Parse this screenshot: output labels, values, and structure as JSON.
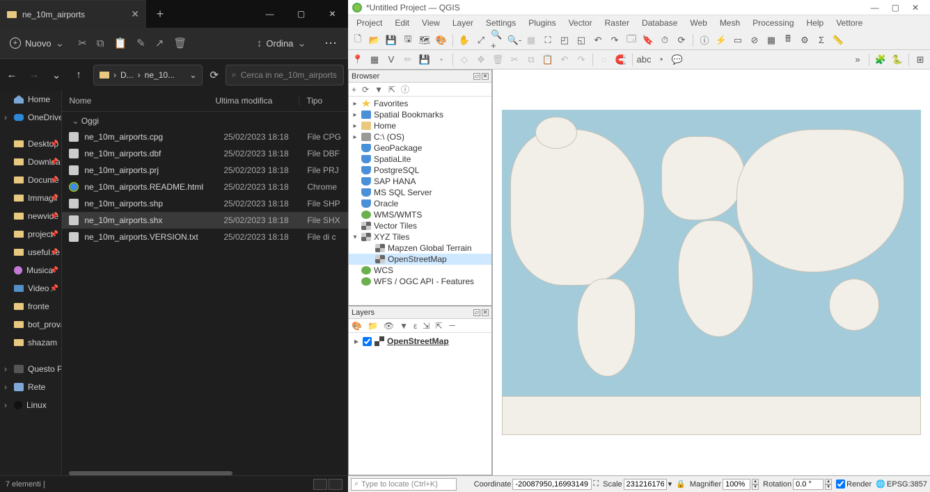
{
  "fe": {
    "tab_title": "ne_10m_airports",
    "new_button": "Nuovo",
    "sort_button": "Ordina",
    "breadcrumb": {
      "p1": "D...",
      "sep": "›",
      "p2": "ne_10..."
    },
    "search_placeholder": "Cerca in ne_10m_airports",
    "side_items": [
      {
        "label": "Home",
        "cls": "home",
        "exp": false,
        "pin": false
      },
      {
        "label": "OneDrive -",
        "cls": "od",
        "exp": true,
        "pin": false
      },
      {
        "label": "Desktop",
        "cls": "f",
        "exp": false,
        "pin": true
      },
      {
        "label": "Downloa",
        "cls": "f",
        "exp": false,
        "pin": true
      },
      {
        "label": "Docume",
        "cls": "f",
        "exp": false,
        "pin": true
      },
      {
        "label": "Immagir",
        "cls": "f",
        "exp": false,
        "pin": true
      },
      {
        "label": "newvide",
        "cls": "f",
        "exp": false,
        "pin": true
      },
      {
        "label": "project",
        "cls": "f",
        "exp": false,
        "pin": true
      },
      {
        "label": "useful re",
        "cls": "f",
        "exp": false,
        "pin": true
      },
      {
        "label": "Musica",
        "cls": "mus",
        "exp": false,
        "pin": true
      },
      {
        "label": "Video",
        "cls": "vid",
        "exp": false,
        "pin": true
      },
      {
        "label": "fronte",
        "cls": "f",
        "exp": false,
        "pin": false
      },
      {
        "label": "bot_prova",
        "cls": "f",
        "exp": false,
        "pin": false
      },
      {
        "label": "shazam",
        "cls": "f",
        "exp": false,
        "pin": false
      },
      {
        "label": "Questo PC",
        "cls": "pc",
        "exp": true,
        "pin": false
      },
      {
        "label": "Rete",
        "cls": "net",
        "exp": true,
        "pin": false
      },
      {
        "label": "Linux",
        "cls": "lin",
        "exp": true,
        "pin": false
      }
    ],
    "columns": {
      "c1": "Nome",
      "c2": "Ultima modifica",
      "c3": "Tipo"
    },
    "group": "Oggi",
    "files": [
      {
        "name": "ne_10m_airports.cpg",
        "mod": "25/02/2023 18:18",
        "type": "File CPG",
        "ico": ""
      },
      {
        "name": "ne_10m_airports.dbf",
        "mod": "25/02/2023 18:18",
        "type": "File DBF",
        "ico": ""
      },
      {
        "name": "ne_10m_airports.prj",
        "mod": "25/02/2023 18:18",
        "type": "File PRJ",
        "ico": ""
      },
      {
        "name": "ne_10m_airports.README.html",
        "mod": "25/02/2023 18:18",
        "type": "Chrome",
        "ico": "html"
      },
      {
        "name": "ne_10m_airports.shp",
        "mod": "25/02/2023 18:18",
        "type": "File SHP",
        "ico": ""
      },
      {
        "name": "ne_10m_airports.shx",
        "mod": "25/02/2023 18:18",
        "type": "File SHX",
        "ico": "",
        "sel": true
      },
      {
        "name": "ne_10m_airports.VERSION.txt",
        "mod": "25/02/2023 18:18",
        "type": "File di c",
        "ico": ""
      }
    ],
    "status": "7 elementi"
  },
  "qg": {
    "title": "*Untitled Project — QGIS",
    "menus": [
      "Project",
      "Edit",
      "View",
      "Layer",
      "Settings",
      "Plugins",
      "Vector",
      "Raster",
      "Database",
      "Web",
      "Mesh",
      "Processing",
      "Help",
      "Vettore"
    ],
    "browser": {
      "title": "Browser",
      "items": [
        {
          "label": "Favorites",
          "ico": "fav",
          "exp": "▸"
        },
        {
          "label": "Spatial Bookmarks",
          "ico": "bkm",
          "exp": "▸"
        },
        {
          "label": "Home",
          "ico": "home",
          "exp": "▸"
        },
        {
          "label": "C:\\ (OS)",
          "ico": "drv",
          "exp": "▸"
        },
        {
          "label": "GeoPackage",
          "ico": "db",
          "exp": ""
        },
        {
          "label": "SpatiaLite",
          "ico": "db",
          "exp": ""
        },
        {
          "label": "PostgreSQL",
          "ico": "db",
          "exp": ""
        },
        {
          "label": "SAP HANA",
          "ico": "db",
          "exp": ""
        },
        {
          "label": "MS SQL Server",
          "ico": "db",
          "exp": ""
        },
        {
          "label": "Oracle",
          "ico": "db",
          "exp": ""
        },
        {
          "label": "WMS/WMTS",
          "ico": "wms",
          "exp": ""
        },
        {
          "label": "Vector Tiles",
          "ico": "lyr",
          "exp": ""
        },
        {
          "label": "XYZ Tiles",
          "ico": "lyr",
          "exp": "▾"
        },
        {
          "label": "Mapzen Global Terrain",
          "ico": "lyr",
          "exp": "",
          "indent": 1
        },
        {
          "label": "OpenStreetMap",
          "ico": "lyr",
          "exp": "",
          "indent": 1,
          "sel": true
        },
        {
          "label": "WCS",
          "ico": "wms",
          "exp": ""
        },
        {
          "label": "WFS / OGC API - Features",
          "ico": "wms",
          "exp": ""
        }
      ]
    },
    "layers": {
      "title": "Layers",
      "item": "OpenStreetMap"
    },
    "status": {
      "locator_placeholder": "Type to locate (Ctrl+K)",
      "coord_label": "Coordinate",
      "coord_value": "-20087950,16993149",
      "scale_label": "Scale",
      "scale_value": "231216176",
      "mag_label": "Magnifier",
      "mag_value": "100%",
      "rot_label": "Rotation",
      "rot_value": "0.0 °",
      "render_label": "Render",
      "epsg": "EPSG:3857"
    }
  }
}
